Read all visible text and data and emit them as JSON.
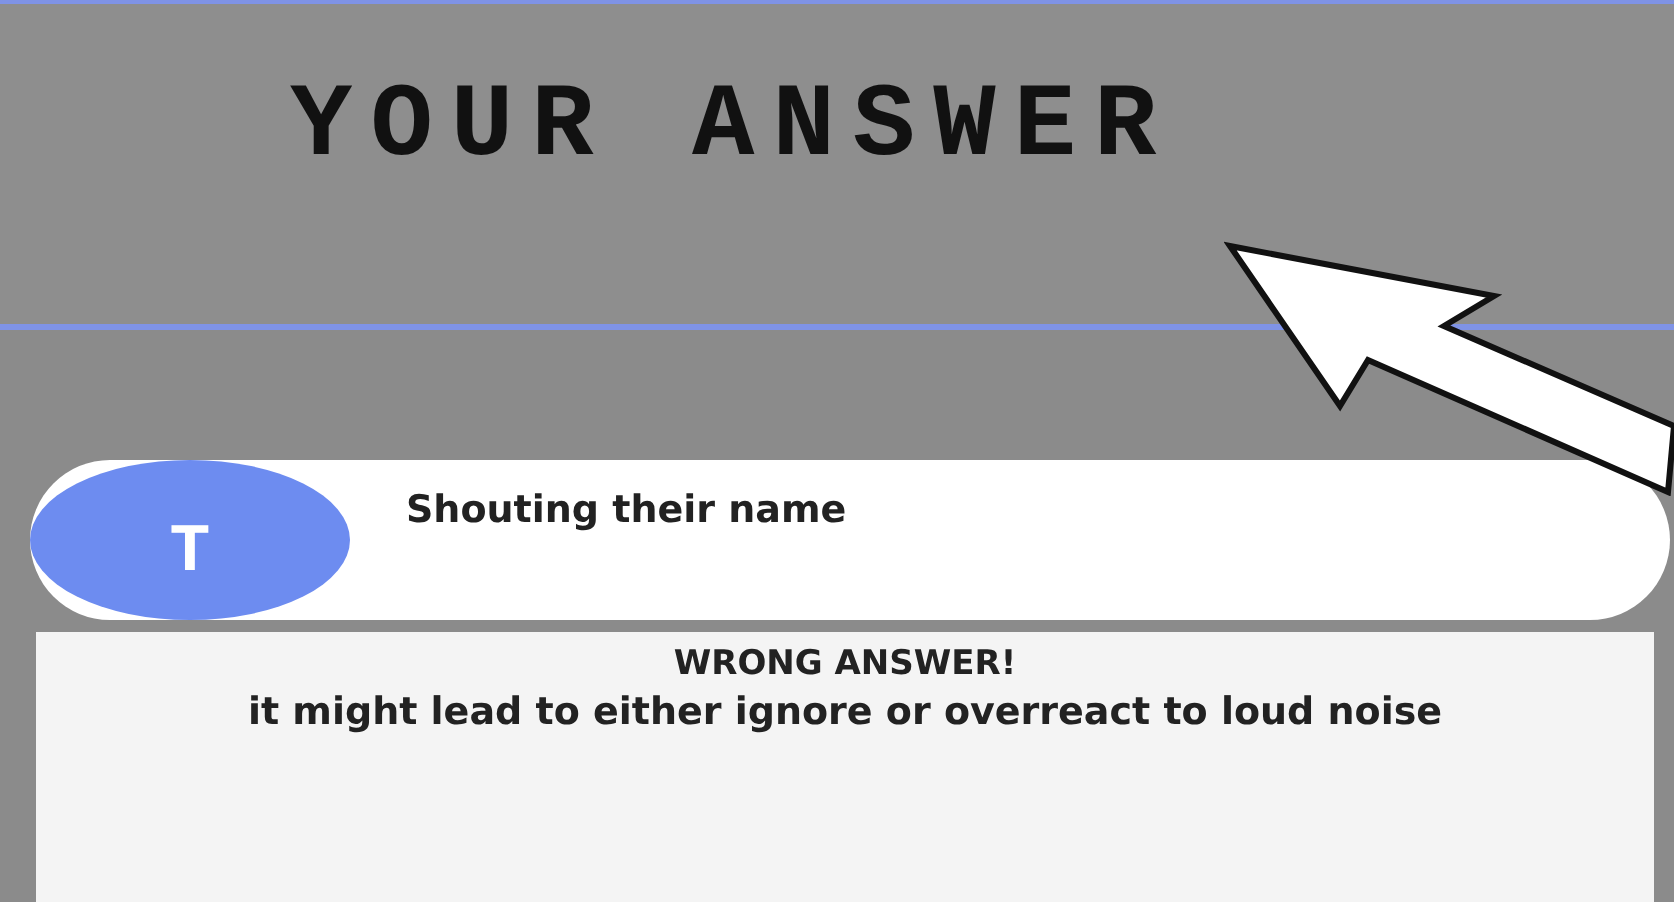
{
  "header": {
    "title": "YOUR ANSWER"
  },
  "answer": {
    "letter": "T",
    "text": "Shouting their name"
  },
  "feedback": {
    "heading": "WRONG ANSWER!",
    "message": "it might lead to either ignore or overreact to loud noise"
  }
}
